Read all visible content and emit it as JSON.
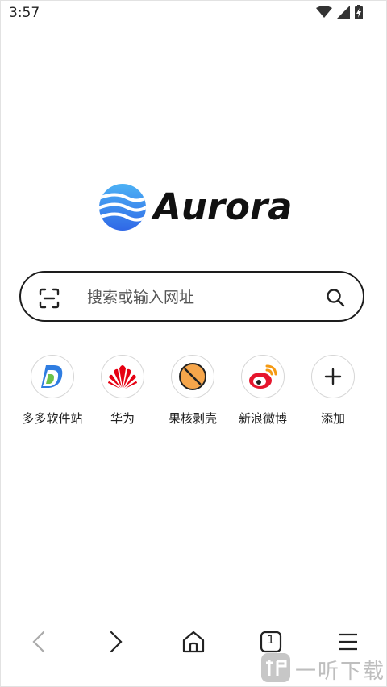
{
  "status_bar": {
    "time": "3:57",
    "icons": [
      "wifi-icon",
      "signal-icon",
      "battery-charging-icon"
    ]
  },
  "brand": {
    "name": "Aurora",
    "logo_colors": [
      "#3aa0f0",
      "#2f6fe6"
    ]
  },
  "search": {
    "placeholder": "搜索或输入网址",
    "left_icon": "scan-icon",
    "right_icon": "search-icon"
  },
  "shortcuts": [
    {
      "label": "多多软件站",
      "icon": "duoduo-logo-icon"
    },
    {
      "label": "华为",
      "icon": "huawei-logo-icon"
    },
    {
      "label": "果核剥壳",
      "icon": "guohe-logo-icon"
    },
    {
      "label": "新浪微博",
      "icon": "weibo-logo-icon"
    },
    {
      "label": "添加",
      "icon": "plus-icon"
    }
  ],
  "bottom_nav": {
    "items": [
      "back-icon",
      "forward-icon",
      "home-icon",
      "tabs-icon",
      "menu-icon"
    ],
    "tab_count": "1"
  },
  "watermark": {
    "text": "一听下载"
  }
}
